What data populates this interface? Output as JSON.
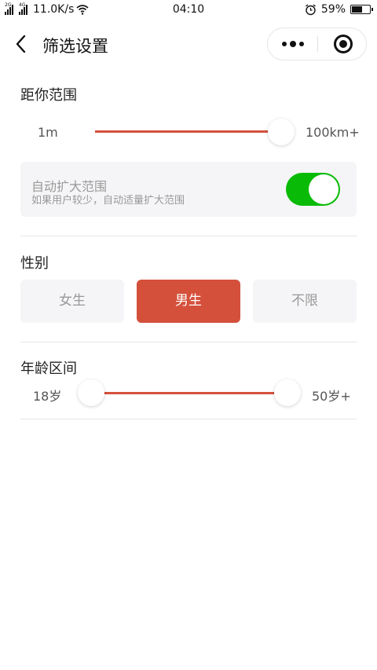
{
  "status_bar": {
    "net_speed": "11.0K/s",
    "time": "04:10",
    "battery": "59%",
    "battery_level": 0.59,
    "sim1": "2G",
    "sim2": "4G"
  },
  "nav": {
    "title": "筛选设置"
  },
  "distance": {
    "title": "距你范围",
    "min_label": "1m",
    "max_label": "100km+",
    "value_fraction": 1.0
  },
  "auto_expand": {
    "title": "自动扩大范围",
    "subtitle": "如果用户较少，自动适量扩大范围",
    "enabled": true
  },
  "gender": {
    "title": "性别",
    "options": [
      "女生",
      "男生",
      "不限"
    ],
    "selected": "男生"
  },
  "age": {
    "title": "年龄区间",
    "min_label": "18岁",
    "max_label": "50岁+",
    "low_fraction": 0.0,
    "high_fraction": 1.0
  },
  "colors": {
    "accent": "#d4503b",
    "switch_on": "#09bb07"
  }
}
